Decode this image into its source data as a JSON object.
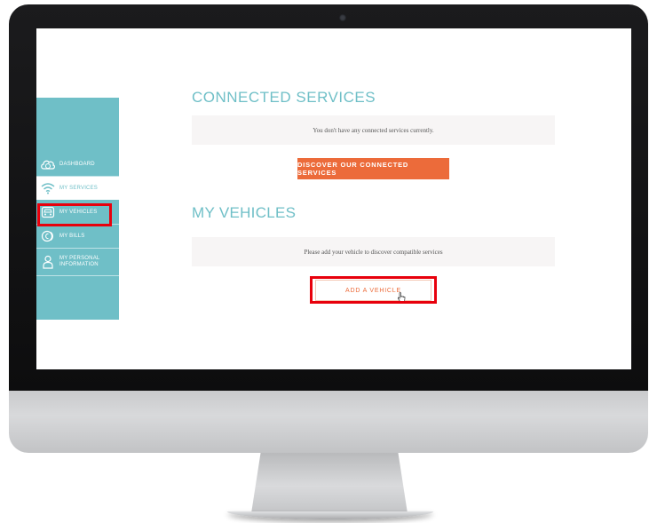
{
  "colors": {
    "sidebar": "#6fbfc7",
    "accent_orange": "#ec6b3a",
    "highlight_red": "#e8000c",
    "notice_bg": "#f7f5f5"
  },
  "sidebar": {
    "items": [
      {
        "label": "DASHBOARD",
        "icon": "cloud-icon"
      },
      {
        "label": "MY SERVICES",
        "icon": "wifi-icon"
      },
      {
        "label": "MY VEHICLES",
        "icon": "car-icon"
      },
      {
        "label": "MY BILLS",
        "icon": "coins-icon"
      },
      {
        "label": "MY PERSONAL INFORMATION",
        "icon": "person-icon"
      }
    ]
  },
  "main": {
    "connected_services": {
      "heading": "CONNECTED SERVICES",
      "notice": "You don't have any connected services currently.",
      "button": "DISCOVER OUR CONNECTED SERVICES"
    },
    "my_vehicles": {
      "heading": "MY VEHICLES",
      "notice": "Please add your vehicle to discover compatible services",
      "button": "ADD A VEHICLE"
    }
  }
}
